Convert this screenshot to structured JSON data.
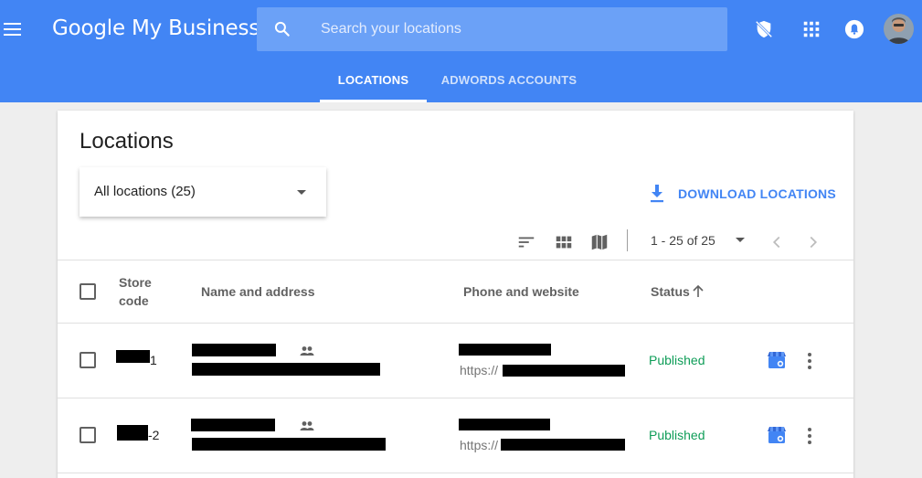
{
  "header": {
    "logo_text": "Google My Business",
    "search_placeholder": "Search your locations"
  },
  "tabs": [
    {
      "label": "LOCATIONS",
      "active": true
    },
    {
      "label": "ADWORDS ACCOUNTS",
      "active": false
    }
  ],
  "card": {
    "title": "Locations",
    "filter_label": "All locations (25)",
    "download_label": "DOWNLOAD LOCATIONS",
    "pagination": "1 - 25 of 25"
  },
  "table": {
    "columns": {
      "store_code_line1": "Store",
      "store_code_line2": "code",
      "name_address": "Name and address",
      "phone_website": "Phone and website",
      "status": "Status"
    },
    "rows": [
      {
        "store_code_suffix": "1",
        "url_prefix": "https://",
        "status": "Published"
      },
      {
        "store_code_suffix": "-2",
        "url_prefix": "https://",
        "status": "Published"
      }
    ]
  },
  "colors": {
    "header_blue": "#4285f4",
    "status_green": "#0f9d58",
    "link_blue": "#4285f4"
  },
  "icons": [
    "menu-icon",
    "search-icon",
    "shield-off-icon",
    "apps-grid-icon",
    "notifications-icon",
    "sort-icon",
    "grid-view-icon",
    "map-icon",
    "chevron-left-icon",
    "chevron-right-icon",
    "download-icon",
    "group-icon",
    "store-icon",
    "more-vert-icon",
    "arrow-up-icon"
  ]
}
